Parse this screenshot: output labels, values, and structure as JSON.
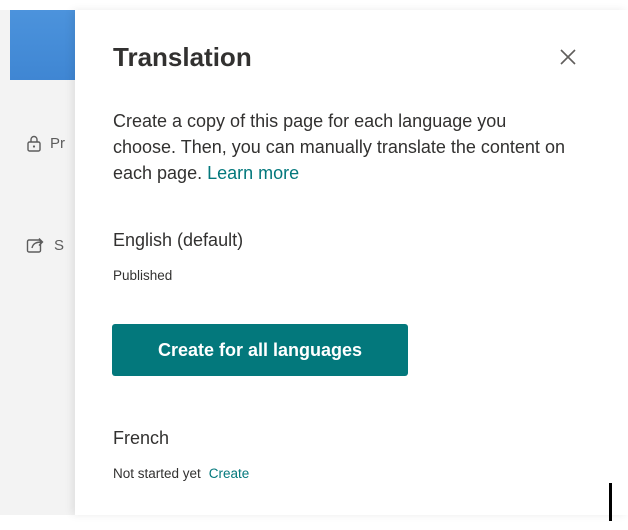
{
  "background": {
    "sidebar_items": [
      {
        "icon": "lock-icon",
        "label": "Pr"
      },
      {
        "icon": "share-icon",
        "label": "S"
      }
    ]
  },
  "panel": {
    "title": "Translation",
    "close_icon": "close-icon",
    "description": "Create a copy of this page for each language you choose. Then, you can manually translate the content on each page.",
    "learn_more_link": "Learn more",
    "default_language": {
      "name": "English (default)",
      "status": "Published"
    },
    "create_all_button": "Create for all languages",
    "languages": [
      {
        "name": "French",
        "status": "Not started yet",
        "action": "Create"
      }
    ]
  },
  "colors": {
    "accent": "#03787c",
    "header_blue": "#4a90d9",
    "text": "#323130"
  }
}
